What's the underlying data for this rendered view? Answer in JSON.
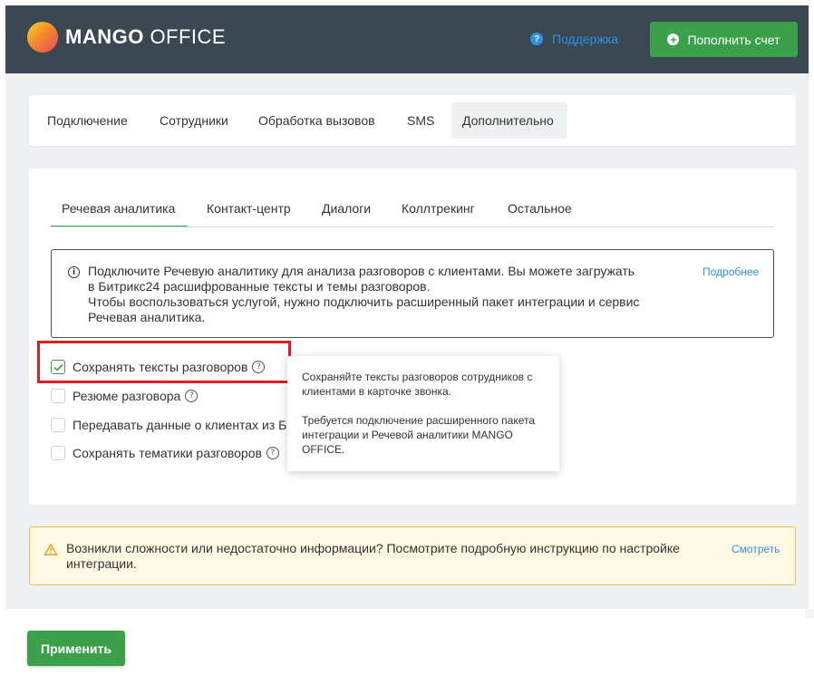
{
  "header": {
    "logo_bold": "MANGO",
    "logo_light": " OFFICE",
    "support_label": "Поддержка",
    "topup_label": "Пополнить счет"
  },
  "nav": {
    "tabs": [
      {
        "label": "Подключение"
      },
      {
        "label": "Сотрудники"
      },
      {
        "label": "Обработка вызовов"
      },
      {
        "label": "SMS"
      },
      {
        "label": "Дополнительно",
        "active": true
      }
    ]
  },
  "subnav": {
    "tabs": [
      {
        "label": "Речевая аналитика",
        "active": true
      },
      {
        "label": "Контакт-центр"
      },
      {
        "label": "Диалоги"
      },
      {
        "label": "Коллтрекинг"
      },
      {
        "label": "Остальное"
      }
    ]
  },
  "info": {
    "line1": "Подключите Речевую аналитику для анализа разговоров с клиентами. Вы можете загружать",
    "line2": "в Битрикс24 расшифрованные тексты и темы разговоров.",
    "line3": "Чтобы воспользоваться услугой, нужно подключить расширенный пакет интеграции и сервис",
    "line4": "Речевая аналитика.",
    "more_link": "Подробнее"
  },
  "options": [
    {
      "label": "Сохранять тексты разговоров",
      "checked": true
    },
    {
      "label": "Резюме разговора",
      "checked": false
    },
    {
      "label": "Передавать данные о клиентах из Б",
      "checked": false
    },
    {
      "label": "Сохранять тематики разговоров",
      "checked": false
    }
  ],
  "tooltip": {
    "para1": "Сохраняйте тексты разговоров сотрудников с клиентами в карточке звонка.",
    "para2": "Требуется подключение расширенного пакета интеграции и Речевой аналитики MANGO OFFICE."
  },
  "warning": {
    "text": "Возникли сложности или недостаточно информации? Посмотрите подробную инструкцию по настройке интеграции.",
    "link": "Смотреть"
  },
  "footer": {
    "apply_label": "Применить"
  },
  "colors": {
    "header_bg": "#3a4852",
    "accent_green": "#3aa14a",
    "link_blue": "#2d8fe8",
    "highlight_red": "#e31c23",
    "warning_bg": "#fff8e3",
    "warning_border": "#f0c24a"
  },
  "icons": {
    "support": "question-circle-icon",
    "topup": "plus-circle-icon",
    "info": "info-circle-icon",
    "help": "question-circle-icon",
    "warning": "warning-triangle-icon",
    "check": "checkmark-icon"
  }
}
